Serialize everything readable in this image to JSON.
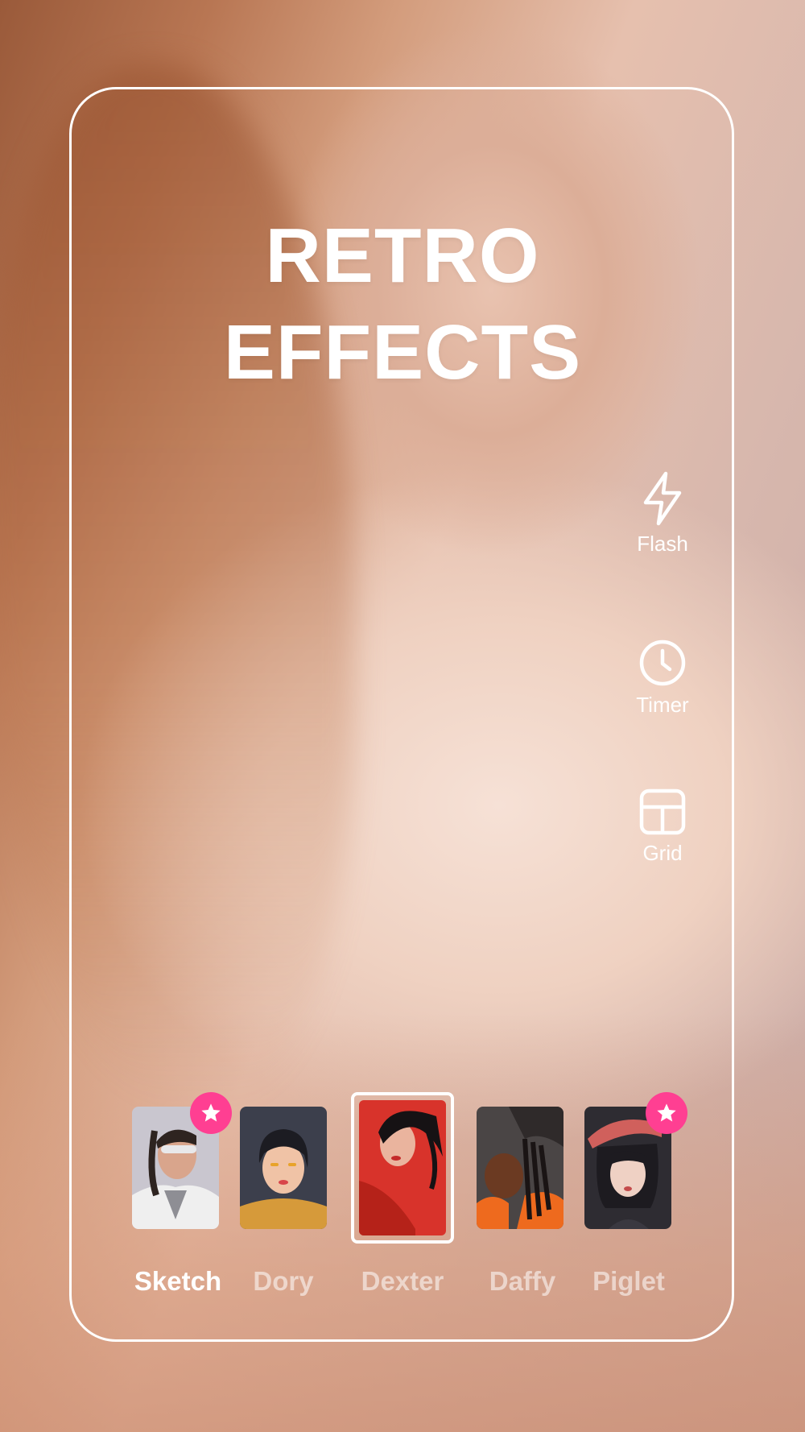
{
  "headline": {
    "line1": "RETRO",
    "line2": "EFFECTS"
  },
  "tools": [
    {
      "label": "Flash",
      "icon": "lightning-icon"
    },
    {
      "label": "Timer",
      "icon": "clock-icon"
    },
    {
      "label": "Grid",
      "icon": "grid-icon"
    }
  ],
  "filters": [
    {
      "name": "Sketch",
      "premium": true,
      "active": true
    },
    {
      "name": "Dory",
      "premium": false,
      "active": false
    },
    {
      "name": "Dexter",
      "premium": false,
      "selected": true
    },
    {
      "name": "Daffy",
      "premium": false,
      "active": false
    },
    {
      "name": "Piglet",
      "premium": true,
      "active": false
    }
  ],
  "colors": {
    "badge": "#ff3f92",
    "frame": "#ffffff",
    "text": "#ffffff"
  }
}
